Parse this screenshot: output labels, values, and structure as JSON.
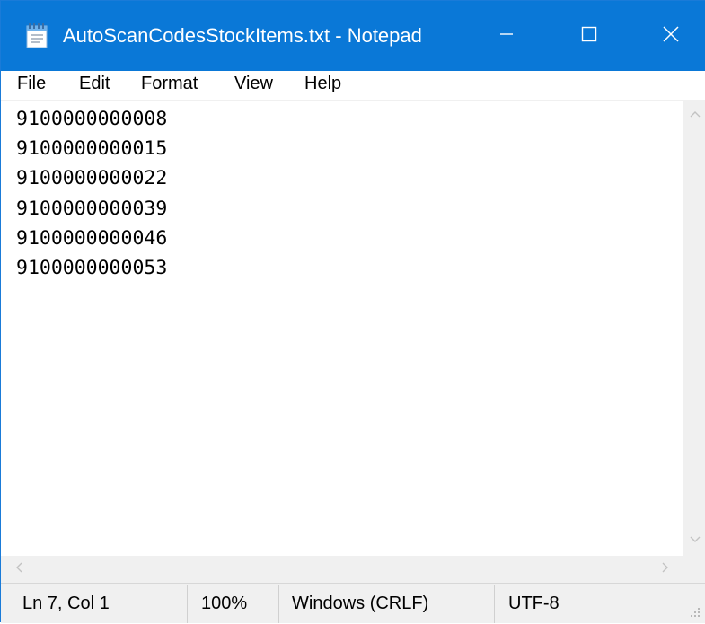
{
  "window": {
    "title": "AutoScanCodesStockItems.txt - Notepad",
    "app_icon": "notepad-icon",
    "accent_color": "#0a78d7",
    "controls": {
      "minimize_icon": "minimize-icon",
      "maximize_icon": "maximize-icon",
      "close_icon": "close-icon"
    }
  },
  "menu": {
    "items": [
      {
        "label": "File"
      },
      {
        "label": "Edit"
      },
      {
        "label": "Format"
      },
      {
        "label": "View"
      },
      {
        "label": "Help"
      }
    ]
  },
  "editor": {
    "lines": [
      "9100000000008",
      "9100000000015",
      "9100000000022",
      "9100000000039",
      "9100000000046",
      "9100000000053"
    ]
  },
  "status": {
    "position": "Ln 7, Col 1",
    "zoom": "100%",
    "line_ending": "Windows (CRLF)",
    "encoding": "UTF-8"
  }
}
